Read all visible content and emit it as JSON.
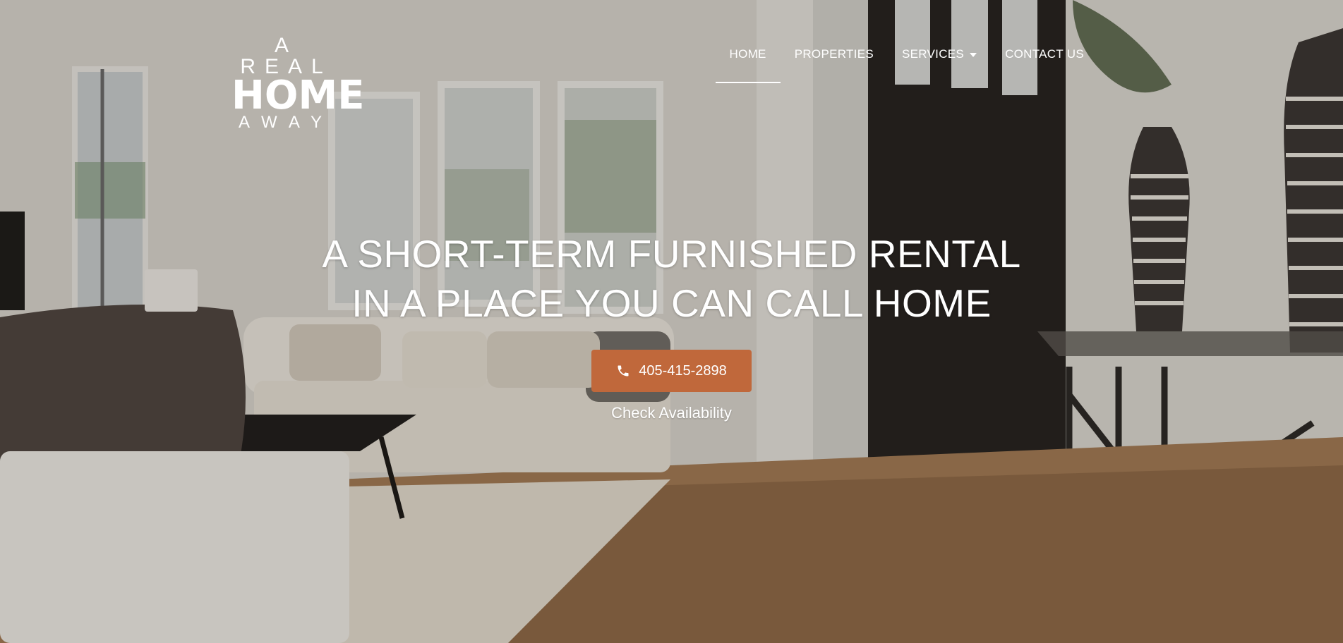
{
  "logo": {
    "line1": "A REAL",
    "line2": "HOME",
    "line3": "AWAY"
  },
  "nav": {
    "items": [
      {
        "label": "HOME"
      },
      {
        "label": "PROPERTIES"
      },
      {
        "label": "SERVICES"
      },
      {
        "label": "CONTACT US"
      }
    ]
  },
  "hero": {
    "headline_line1": "A SHORT-TERM FURNISHED RENTAL",
    "headline_line2": "IN A PLACE YOU CAN CALL HOME",
    "phone_label": "405-415-2898",
    "check_availability": "Check Availability"
  },
  "colors": {
    "accent": "#c0683b",
    "text": "#ffffff"
  }
}
